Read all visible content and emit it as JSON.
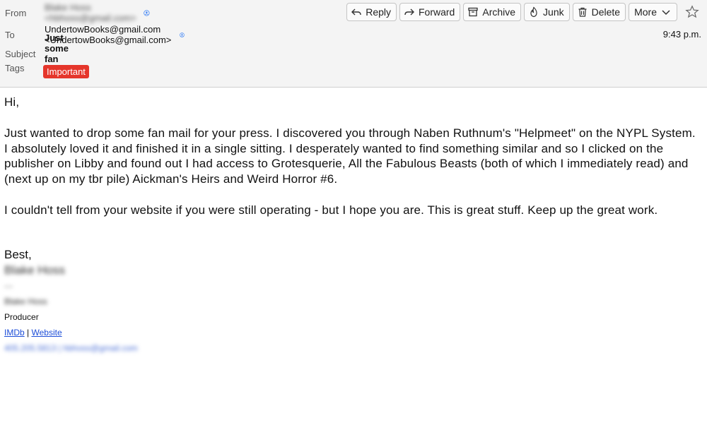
{
  "header": {
    "from_label": "From",
    "from_value": "Blake Hoss <hbhoss@gmail.com>",
    "to_label": "To",
    "to_value": "UndertowBooks@gmail.com <UndertowBooks@gmail.com>",
    "subject_label": "Subject",
    "subject_value": "Just some fan mail",
    "tags_label": "Tags",
    "tag": "Important",
    "time": "9:43 p.m."
  },
  "toolbar": {
    "reply": "Reply",
    "forward": "Forward",
    "archive": "Archive",
    "junk": "Junk",
    "delete": "Delete",
    "more": "More"
  },
  "message": {
    "greeting": "Hi,",
    "paragraph1": "Just wanted to drop some fan mail for your press. I discovered you through Naben Ruthnum's \"Helpmeet\" on the NYPL System. I absolutely loved it and finished it in a single sitting. I desperately wanted to find something similar and so I clicked on the publisher on Libby and found out I had access to Grotesquerie, All the Fabulous Beasts (both of which I immediately read) and (next up on my tbr pile) Aickman's Heirs and Weird Horror #6.",
    "paragraph2": "I couldn't tell from your website if you were still operating - but I hope you are. This is great stuff. Keep up the great work.",
    "closing": "Best,"
  },
  "signature": {
    "name": "Blake Hoss",
    "dashes": "---",
    "name_small": "Blake Hoss",
    "role": "Producer",
    "link1": "IMDb",
    "sep": "|",
    "link2": "Website",
    "contact": "405.205.5813 | hbhoss@gmail.com"
  },
  "colors": {
    "tag_bg": "#e5362b",
    "link": "#1d4ed8",
    "header_bg": "#f4f4f4"
  }
}
